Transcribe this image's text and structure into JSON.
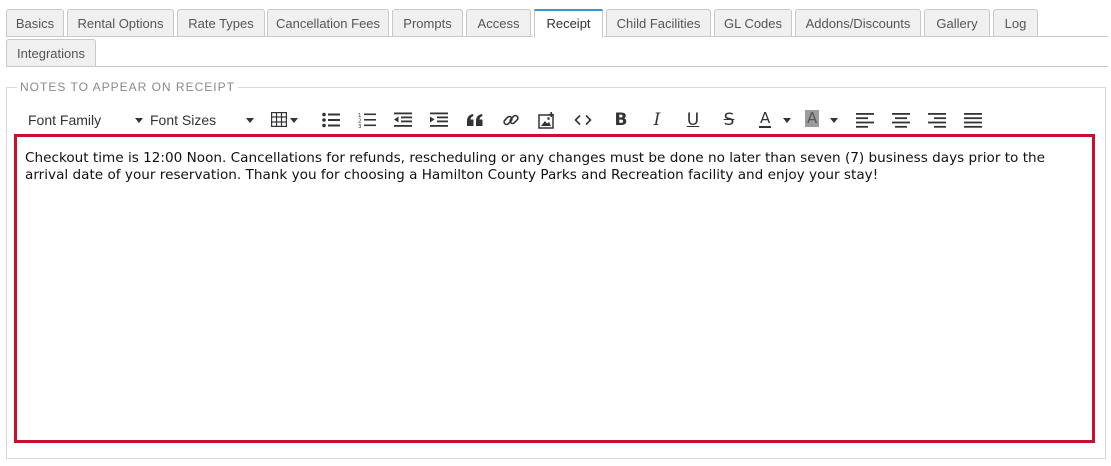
{
  "tabs": [
    {
      "label": "Basics"
    },
    {
      "label": "Rental Options"
    },
    {
      "label": "Rate Types"
    },
    {
      "label": "Cancellation Fees"
    },
    {
      "label": "Prompts"
    },
    {
      "label": "Access"
    },
    {
      "label": "Receipt",
      "active": true
    },
    {
      "label": "Child Facilities"
    },
    {
      "label": "GL Codes"
    },
    {
      "label": "Addons/Discounts"
    },
    {
      "label": "Gallery"
    },
    {
      "label": "Log"
    },
    {
      "label": "Integrations"
    }
  ],
  "section": {
    "legend": "NOTES TO APPEAR ON RECEIPT"
  },
  "toolbar": {
    "font_family_label": "Font Family",
    "font_sizes_label": "Font Sizes",
    "buttons": [
      "table-icon",
      "bullet-list-icon",
      "numbered-list-icon",
      "outdent-icon",
      "indent-icon",
      "blockquote-icon",
      "link-icon",
      "image-icon",
      "code-icon",
      "bold-icon",
      "italic-icon",
      "underline-icon",
      "strikethrough-icon",
      "text-color-icon",
      "highlight-color-icon",
      "align-left-icon",
      "align-center-icon",
      "align-right-icon",
      "align-justify-icon"
    ]
  },
  "editor": {
    "content": "Checkout time is 12:00 Noon. Cancellations for refunds, rescheduling or any changes must be done no later than seven (7) business days prior to the arrival date of your reservation. Thank you for choosing a Hamilton County Parks and Recreation facility and enjoy your stay!"
  },
  "colors": {
    "active_tab_accent": "#2e9ad0",
    "editor_border": "#c8102e"
  }
}
